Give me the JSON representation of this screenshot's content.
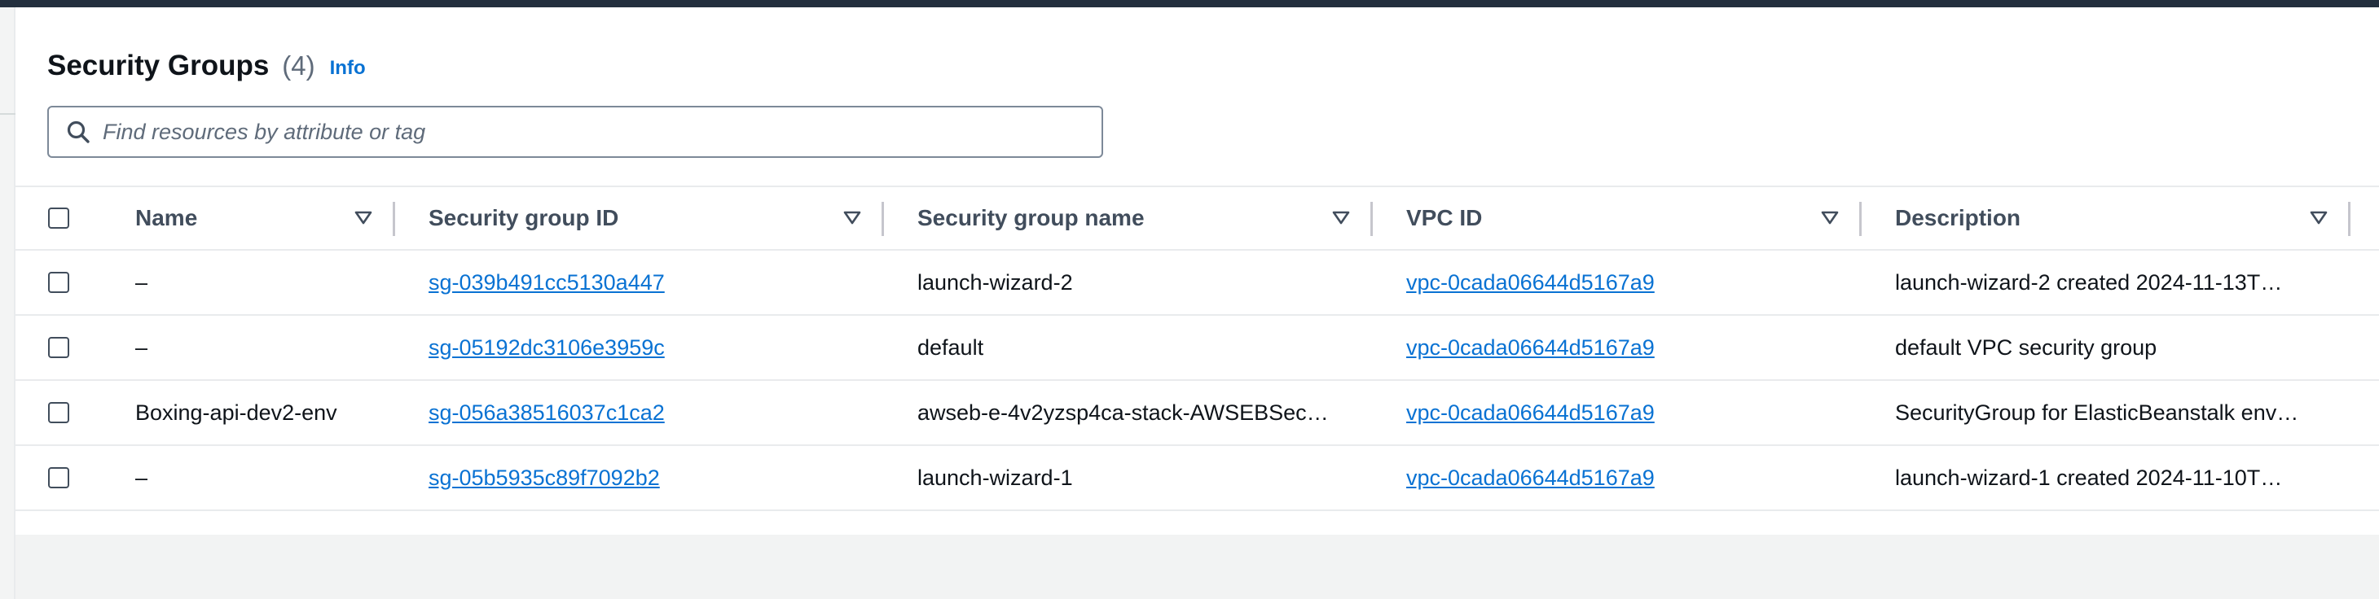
{
  "header": {
    "title": "Security Groups",
    "count": "(4)",
    "info_label": "Info"
  },
  "search": {
    "placeholder": "Find resources by attribute or tag",
    "value": ""
  },
  "icons": {
    "search": "search-icon",
    "sort": "caret-down-icon"
  },
  "colors": {
    "link": "#0972d3",
    "top_bar": "#232f3e",
    "header_text": "#414d5c"
  },
  "table": {
    "columns": [
      "Name",
      "Security group ID",
      "Security group name",
      "VPC ID",
      "Description"
    ],
    "rows": [
      {
        "name": "–",
        "sg_id": "sg-039b491cc5130a447",
        "sg_name": "launch-wizard-2",
        "vpc_id": "vpc-0cada06644d5167a9",
        "description": "launch-wizard-2 created 2024-11-13T…"
      },
      {
        "name": "–",
        "sg_id": "sg-05192dc3106e3959c",
        "sg_name": "default",
        "vpc_id": "vpc-0cada06644d5167a9",
        "description": "default VPC security group"
      },
      {
        "name": "Boxing-api-dev2-env",
        "sg_id": "sg-056a38516037c1ca2",
        "sg_name": "awseb-e-4v2yzsp4ca-stack-AWSEBSec…",
        "vpc_id": "vpc-0cada06644d5167a9",
        "description": "SecurityGroup for ElasticBeanstalk env…"
      },
      {
        "name": "–",
        "sg_id": "sg-05b5935c89f7092b2",
        "sg_name": "launch-wizard-1",
        "vpc_id": "vpc-0cada06644d5167a9",
        "description": "launch-wizard-1 created 2024-11-10T…"
      }
    ]
  }
}
